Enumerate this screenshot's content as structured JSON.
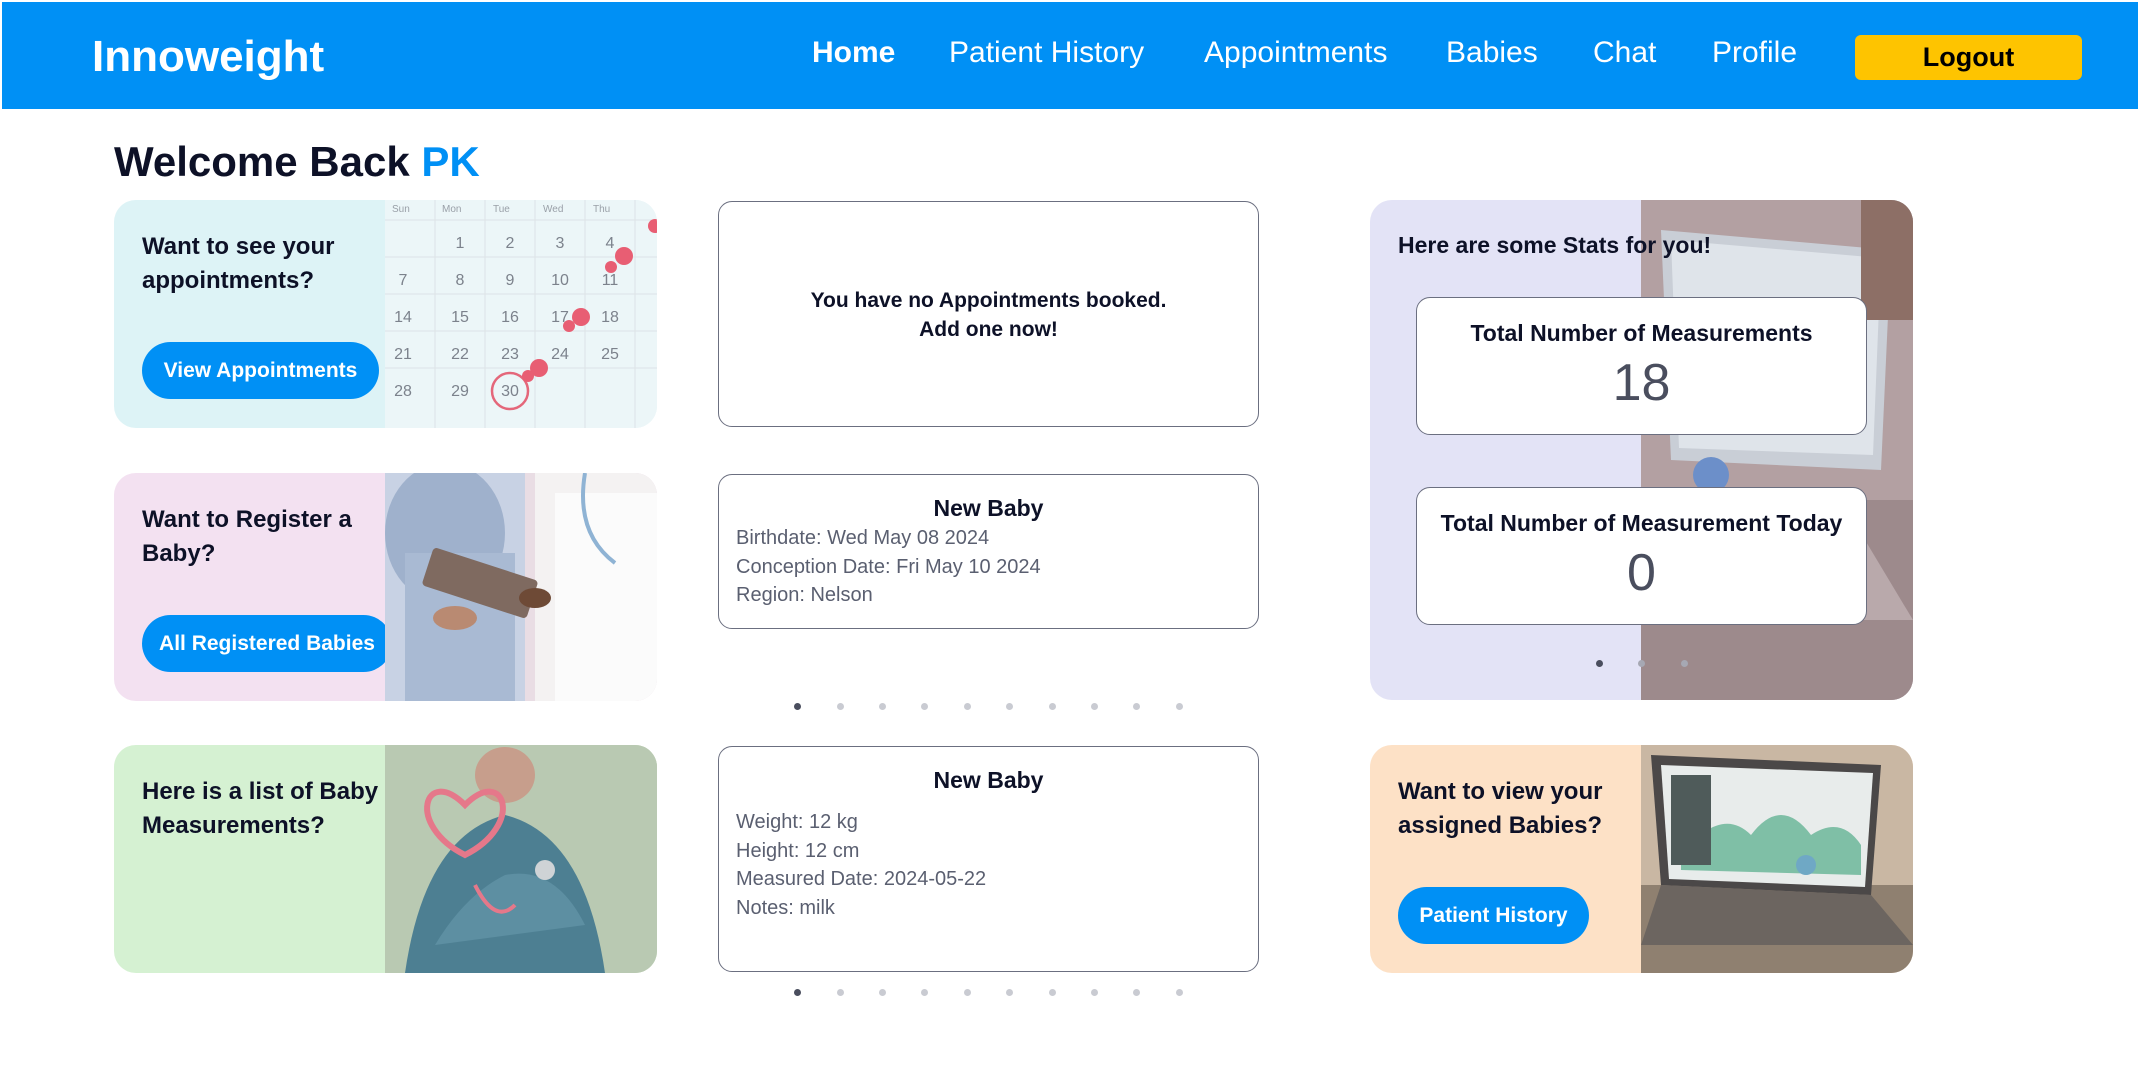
{
  "navbar": {
    "brand": "Innoweight",
    "links": [
      "Home",
      "Patient History",
      "Appointments",
      "Babies",
      "Chat",
      "Profile"
    ],
    "logout_label": "Logout",
    "accent": "#0090f5",
    "logout_color": "#fec400"
  },
  "welcome": {
    "prefix": "Welcome Back",
    "user": "PK"
  },
  "features": [
    {
      "text": "Want to see your appointments?",
      "button": "View Appointments",
      "bg": "#ddf3f6",
      "image": "calendar-image"
    },
    {
      "text": "Want to Register a Baby?",
      "button": "All Registered Babies",
      "bg": "#f3e1f1",
      "image": "doctor-image"
    },
    {
      "text": "Here is a list of Baby Measurements?",
      "bg": "#d5f1d2",
      "image": "stethoscope-heart-image"
    },
    {
      "text": "Want to view your assigned Babies?",
      "button": "Patient History",
      "bg": "#fde1c6",
      "image": "laptop-image"
    }
  ],
  "calendar": {
    "headers": [
      "Sun",
      "Mon",
      "Tue",
      "Wed",
      "Thu"
    ],
    "rows": [
      [
        "",
        "1",
        "2",
        "3",
        "4"
      ],
      [
        "7",
        "8",
        "9",
        "10",
        "11"
      ],
      [
        "14",
        "15",
        "16",
        "17",
        "18"
      ],
      [
        "21",
        "22",
        "23",
        "24",
        "25"
      ],
      [
        "28",
        "29",
        "30",
        "",
        ""
      ]
    ]
  },
  "appointments_card": {
    "line1": "You have no Appointments booked.",
    "line2": "Add one now!"
  },
  "baby_card": {
    "title": "New Baby",
    "birthdate": "Birthdate: Wed May 08 2024",
    "conception": "Conception Date: Fri May 10 2024",
    "region": "Region: Nelson",
    "carousel_total": 10,
    "carousel_active": 1
  },
  "measurement_card": {
    "title": "New Baby",
    "weight": "Weight: 12 kg",
    "height": "Height: 12 cm",
    "date": "Measured Date: 2024-05-22",
    "notes": "Notes: milk",
    "carousel_total": 10,
    "carousel_active": 1
  },
  "stats": {
    "heading": "Here are some Stats for you!",
    "total_label": "Total Number of Measurements",
    "total_value": "18",
    "today_label": "Total Number of Measurement Today",
    "today_value": "0",
    "carousel_total": 3,
    "carousel_active": 1
  }
}
